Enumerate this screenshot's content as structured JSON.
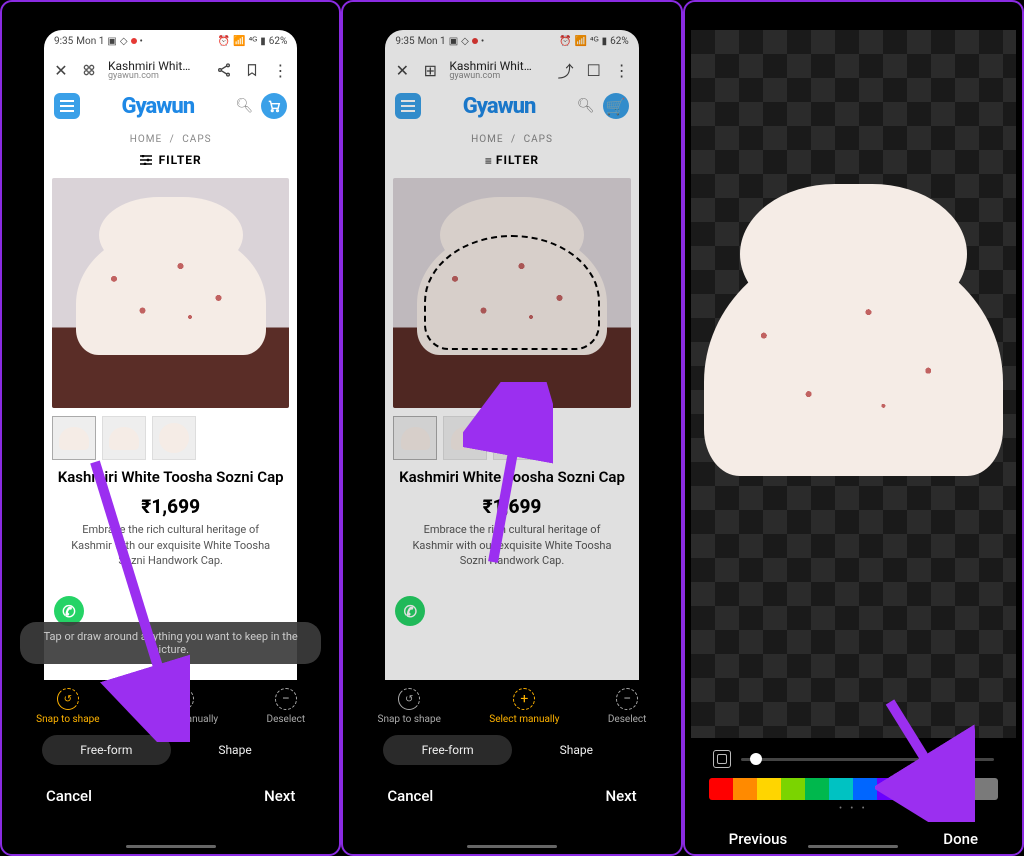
{
  "status": {
    "time": "9:35",
    "day": "Mon 1",
    "battery": "62%"
  },
  "browser": {
    "title": "Kashmiri Whit…",
    "domain": "gyawun.com"
  },
  "site": {
    "brand": "Gyawun",
    "crumb_home": "HOME",
    "crumb_sep": "/",
    "crumb_cat": "CAPS",
    "filter": "FILTER"
  },
  "product": {
    "title": "Kashmiri White Toosha Sozni Cap",
    "price": "₹1,699",
    "desc1": "Embrace the rich cultural heritage of Kashmir with our exquisite White Toosha Sozni Handwork Cap.",
    "desc2": "Embrace the rich cultural heritage of Kashmir with our exquisite White Toosha Sozni Handwork Cap."
  },
  "toast": "Tap or draw around anything you want to keep in the picture.",
  "tools": {
    "snap": "Snap to shape",
    "select": "Select manually",
    "deselect": "Deselect"
  },
  "chips": {
    "free": "Free-form",
    "shape": "Shape"
  },
  "nav": {
    "cancel": "Cancel",
    "next": "Next",
    "previous": "Previous",
    "done": "Done"
  },
  "palette": [
    "#ff0000",
    "#ff8a00",
    "#ffd500",
    "#7bd400",
    "#00b84d",
    "#00c2c2",
    "#0066ff",
    "#6a00ff",
    "#ff00c8",
    "#ffffff",
    "#000000",
    "#7a7a7a"
  ]
}
